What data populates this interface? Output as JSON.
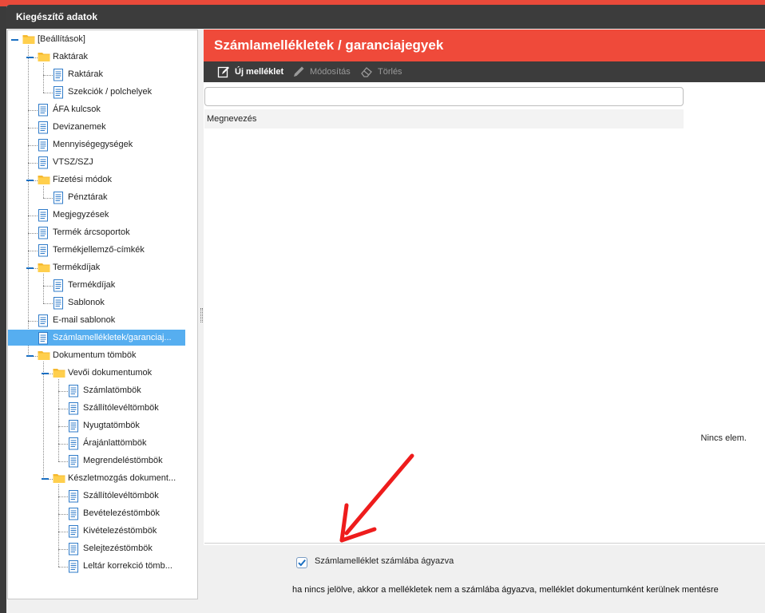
{
  "window": {
    "title": "Kiegészítő adatok"
  },
  "tree": {
    "items": [
      {
        "label": "[Beállítások]",
        "icon": "folder-icon",
        "level": 0
      },
      {
        "label": "Raktárak",
        "icon": "folder-icon",
        "level": 1
      },
      {
        "label": "Raktárak",
        "icon": "document-icon",
        "level": 2
      },
      {
        "label": "Szekciók / polchelyek",
        "icon": "document-icon",
        "level": 2
      },
      {
        "label": "ÁFA kulcsok",
        "icon": "document-icon",
        "level": 1
      },
      {
        "label": "Devizanemek",
        "icon": "document-icon",
        "level": 1
      },
      {
        "label": "Mennyiségegységek",
        "icon": "document-icon",
        "level": 1
      },
      {
        "label": "VTSZ/SZJ",
        "icon": "document-icon",
        "level": 1
      },
      {
        "label": "Fizetési módok",
        "icon": "folder-icon",
        "level": 1
      },
      {
        "label": "Pénztárak",
        "icon": "document-icon",
        "level": 2
      },
      {
        "label": "Megjegyzések",
        "icon": "document-icon",
        "level": 1
      },
      {
        "label": "Termék árcsoportok",
        "icon": "document-icon",
        "level": 1
      },
      {
        "label": "Termékjellemző-címkék",
        "icon": "document-icon",
        "level": 1
      },
      {
        "label": "Termékdíjak",
        "icon": "folder-icon",
        "level": 1
      },
      {
        "label": "Termékdíjak",
        "icon": "document-icon",
        "level": 2
      },
      {
        "label": "Sablonok",
        "icon": "document-icon",
        "level": 2
      },
      {
        "label": "E-mail sablonok",
        "icon": "document-icon",
        "level": 1
      },
      {
        "label": "Számlamellékletek/garanciaj...",
        "icon": "document-icon",
        "level": 1,
        "selected": true
      },
      {
        "label": "Dokumentum tömbök",
        "icon": "folder-icon",
        "level": 1
      },
      {
        "label": "Vevői dokumentumok",
        "icon": "folder-icon",
        "level": 2
      },
      {
        "label": "Számlatömbök",
        "icon": "document-icon",
        "level": 3
      },
      {
        "label": "Szállítólevéltömbök",
        "icon": "document-icon",
        "level": 3
      },
      {
        "label": "Nyugtatömbök",
        "icon": "document-icon",
        "level": 3
      },
      {
        "label": "Árajánlattömbök",
        "icon": "document-icon",
        "level": 3
      },
      {
        "label": "Megrendeléstömbök",
        "icon": "document-icon",
        "level": 3
      },
      {
        "label": "Készletmozgás dokument...",
        "icon": "folder-icon",
        "level": 2
      },
      {
        "label": "Szállítólevéltömbök",
        "icon": "document-icon",
        "level": 3
      },
      {
        "label": "Bevételezéstömbök",
        "icon": "document-icon",
        "level": 3
      },
      {
        "label": "Kivételezéstömbök",
        "icon": "document-icon",
        "level": 3
      },
      {
        "label": "Selejtezéstömbök",
        "icon": "document-icon",
        "level": 3
      },
      {
        "label": "Leltár korrekció tömb...",
        "icon": "document-icon",
        "level": 3
      }
    ]
  },
  "main": {
    "title": "Számlamellékletek / garanciajegyek",
    "toolbar": {
      "new_label": "Új melléklet",
      "edit_label": "Módosítás",
      "delete_label": "Törlés"
    },
    "search": {
      "placeholder": "",
      "value": ""
    },
    "grid": {
      "columns": [
        "Megnevezés"
      ],
      "empty_text": "Nincs elem."
    },
    "embed_checkbox": {
      "label": "Számlamelléklet számlába ágyazva",
      "checked": true
    },
    "hint": "ha nincs jelölve, akkor a mellékletek nem a számlába ágyazva, melléklet dokumentumként kerülnek mentésre"
  },
  "colors": {
    "accent": "#ef4a3a",
    "titlebar": "#3c3c3c",
    "selection": "#56aef0",
    "annotation_arrow": "#ee1c1c"
  }
}
